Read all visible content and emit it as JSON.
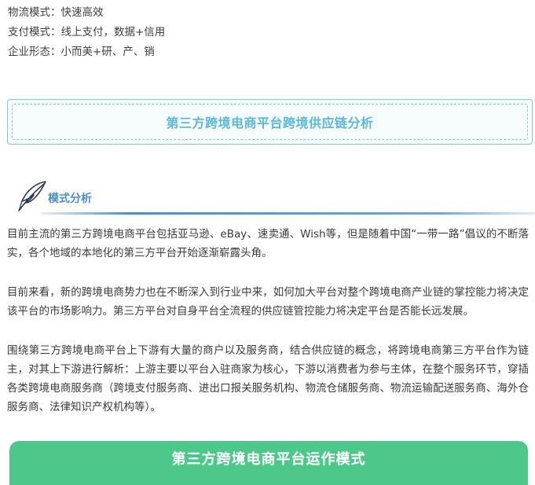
{
  "mode_lines": [
    "物流模式：快速高效",
    "支付模式：线上支付，数据+信用",
    "企业形态：小而美+研、产、销"
  ],
  "title_box": {
    "text": "第三方跨境电商平台跨境供应链分析"
  },
  "section": {
    "icon": "feather-pen-icon",
    "title": "模式分析"
  },
  "paragraphs": [
    "目前主流的第三方跨境电商平台包括亚马逊、eBay、速卖通、Wish等，但是随着中国“一带一路”倡议的不断落实，各个地域的本地化的第三方平台开始逐渐崭露头角。",
    "目前来看，新的跨境电商势力也在不断深入到行业中来，如何加大平台对整个跨境电商产业链的掌控能力将决定该平台的市场影响力。第三方平台对自身平台全流程的供应链管控能力将决定平台是否能长远发展。",
    "围绕第三方跨境电商平台上下游有大量的商户以及服务商，结合供应链的概念，将跨境电商第三方平台作为链主，对其上下游进行解析：上游主要以平台入驻商家为核心，下游以消费者为参与主体，在整个服务环节，穿插各类跨境电商服务商（跨境支付服务商、进出口报关服务机构、物流仓储服务商、物流运输配送服务商、海外仓服务商、法律知识产权机构等）。"
  ],
  "banner": {
    "text": "第三方跨境电商平台运作模式"
  },
  "colors": {
    "title_box_border": "#7fc6de",
    "title_box_text": "#5bb8da",
    "section_title": "#4a90c8",
    "banner_bg": "#4cc98a",
    "body_text": "#3a3a3a"
  }
}
